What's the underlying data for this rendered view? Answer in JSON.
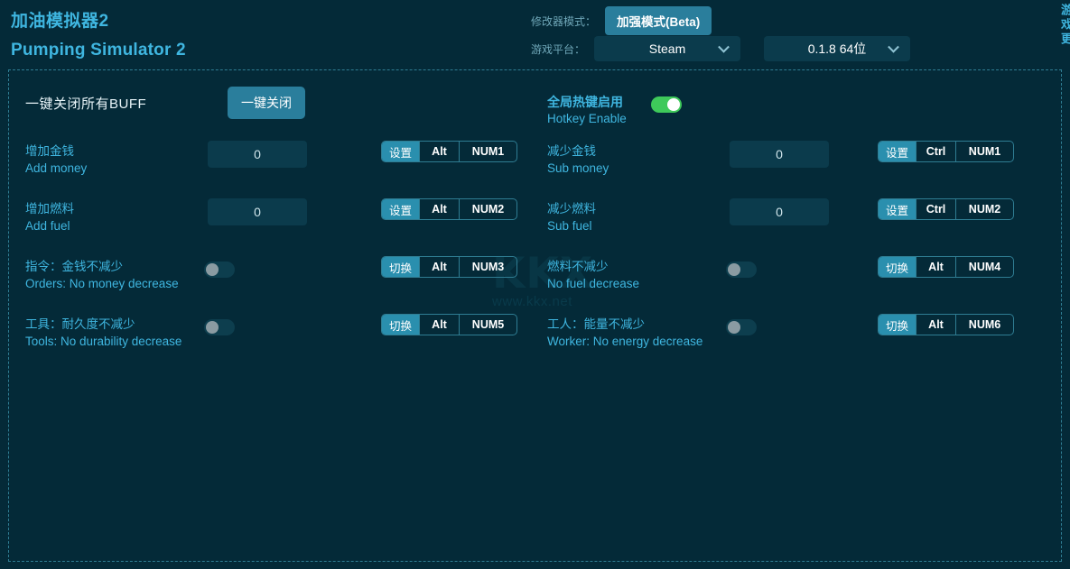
{
  "header": {
    "title_cn": "加油模拟器2",
    "title_en": "Pumping Simulator 2",
    "mode_label": "修改器模式：",
    "mode_button": "加强模式(Beta)",
    "platform_label": "游戏平台：",
    "platform_value": "Steam",
    "version_value": "0.1.8 64位",
    "chevron_icon": "chevron-down-icon"
  },
  "buff": {
    "label": "一键关闭所有BUFF",
    "button": "一键关闭"
  },
  "hotkey": {
    "label_cn": "全局热键启用",
    "label_en": "Hotkey Enable",
    "enabled": true
  },
  "rows": [
    {
      "left": {
        "label_cn": "增加金钱",
        "label_en": "Add money",
        "control": "input",
        "value": "0",
        "hk_action": "设置",
        "hk_mod": "Alt",
        "hk_num": "NUM1"
      },
      "right": {
        "label_cn": "减少金钱",
        "label_en": "Sub money",
        "control": "input",
        "value": "0",
        "hk_action": "设置",
        "hk_mod": "Ctrl",
        "hk_num": "NUM1"
      }
    },
    {
      "left": {
        "label_cn": "增加燃料",
        "label_en": "Add fuel",
        "control": "input",
        "value": "0",
        "hk_action": "设置",
        "hk_mod": "Alt",
        "hk_num": "NUM2"
      },
      "right": {
        "label_cn": "减少燃料",
        "label_en": "Sub fuel",
        "control": "input",
        "value": "0",
        "hk_action": "设置",
        "hk_mod": "Ctrl",
        "hk_num": "NUM2"
      }
    },
    {
      "left": {
        "label_cn": "指令：金钱不减少",
        "label_en": "Orders: No money decrease",
        "control": "switch",
        "enabled": false,
        "hk_action": "切换",
        "hk_mod": "Alt",
        "hk_num": "NUM3"
      },
      "right": {
        "label_cn": "燃料不减少",
        "label_en": "No fuel decrease",
        "control": "switch",
        "enabled": false,
        "hk_action": "切换",
        "hk_mod": "Alt",
        "hk_num": "NUM4"
      }
    },
    {
      "left": {
        "label_cn": "工具：耐久度不减少",
        "label_en": "Tools: No durability decrease",
        "control": "switch",
        "enabled": false,
        "hk_action": "切换",
        "hk_mod": "Alt",
        "hk_num": "NUM5"
      },
      "right": {
        "label_cn": "工人：能量不减少",
        "label_en": "Worker: No energy decrease",
        "control": "switch",
        "enabled": false,
        "hk_action": "切换",
        "hk_mod": "Alt",
        "hk_num": "NUM6"
      }
    }
  ],
  "watermark": {
    "logo": "KKX",
    "url": "www.kkx.net"
  },
  "right_strip": {
    "text": "游戏更"
  },
  "colors": {
    "background": "#042a38",
    "accent": "#3fb6e0",
    "button": "#2a7e9c",
    "chip": "#2a8fae",
    "switch_on": "#3ec95a",
    "field": "#0b3b4c",
    "dashed_border": "#2f7d93"
  }
}
